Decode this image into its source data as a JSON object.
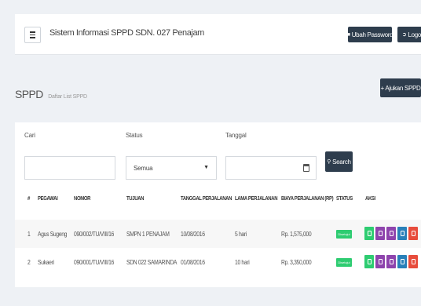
{
  "navbar": {
    "title": "Sistem Informasi SPPD SDN. 027 Penajam",
    "change_password": "Ubah Password",
    "logout": "Logout"
  },
  "page": {
    "title": "SPPD",
    "subtitle": "Daftar List SPPD",
    "add_button": "+ Ajukan SPPD"
  },
  "filters": {
    "search_label": "Cari",
    "search_value": "",
    "status_label": "Status",
    "status_selected": "Semua",
    "date_label": "Tanggal",
    "date_value": "",
    "search_button": "Search"
  },
  "table": {
    "headers": [
      "#",
      "PEGAWAI",
      "NOMOR",
      "TUJUAN",
      "TANGGAL PERJALANAN",
      "LAMA PERJALANAN",
      "BIAYA PERJALANAN (RP)",
      "STATUS",
      "AKSI"
    ],
    "rows": [
      {
        "no": "1",
        "pegawai": "Agus Sugeng",
        "nomor": "090/002/TU/VIII/16",
        "tujuan": "SMPN 1 PENAJAM",
        "tanggal": "10/08/2016",
        "lama": "5 hari",
        "biaya": "Rp. 1,575,000",
        "status": "Disetujui"
      },
      {
        "no": "2",
        "pegawai": "Sukaeri",
        "nomor": "090/001/TU/VIII/16",
        "tujuan": "SDN 022 SAMARINDA",
        "tanggal": "01/08/2016",
        "lama": "10 hari",
        "biaya": "Rp. 3,350,000",
        "status": "Disetujui"
      }
    ],
    "action_icons": [
      "view-icon",
      "file-icon",
      "print-icon",
      "edit-icon",
      "delete-icon"
    ]
  },
  "colors": {
    "dark_button": "#2e3d4d",
    "status_green": "#2ecc71",
    "action_purple": "#8e44ad",
    "action_blue": "#2980b9",
    "action_red": "#e74c3c"
  }
}
